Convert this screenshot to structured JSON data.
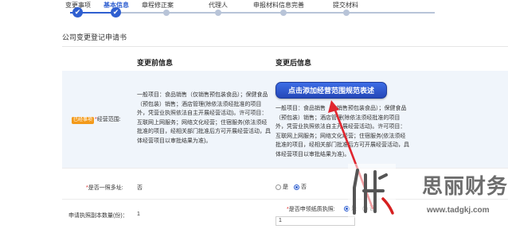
{
  "stepper": {
    "steps": [
      {
        "label": "变更事项",
        "state": "done"
      },
      {
        "label": "基本信息",
        "state": "active"
      },
      {
        "label": "章程修正案",
        "state": "todo"
      },
      {
        "label": "代理人",
        "state": "todo"
      },
      {
        "label": "申报材料信息完善",
        "state": "todo"
      },
      {
        "label": "提交材料",
        "state": "todo"
      }
    ],
    "check_glyph": "✔"
  },
  "form": {
    "title": "公司变更登记申请书",
    "col_before": "变更前信息",
    "col_after": "变更后信息",
    "scope": {
      "badge": "已经事项",
      "required_mark": "*",
      "label": "经营范围:",
      "before_text": "一般项目：食品销售（仅销售预包装食品）；保健食品（预包装）销售；酒店管理(除依法须经批准的项目外，凭营业执照依法自主开展经营活动)。许可项目：互联网上网服务；网络文化经营；住宿服务(依法须经批准的项目，经相关部门批准后方可开展经营活动，具体经营项目以审批结果为准)。",
      "after_text": "一般项目：食品销售（仅销售预包装食品）；保健食品（预包装）销售；酒店管理(除依法须经批准的项目外，凭营业执照依法自主开展经营活动)。许可项目：互联网上网服务；网络文化经营；住宿服务(依法须经批准的项目，经相关部门批准后方可开展经营活动，具体经营项目以审批结果为准)。",
      "button_label": "点击添加经营范围规范表述"
    },
    "multi_address": {
      "required_mark": "*",
      "label": "是否一照多址:",
      "before_value": "否",
      "options": [
        "是",
        "否"
      ],
      "selected": "否"
    },
    "receive_license": {
      "required_mark": "*",
      "label": "是否申领纸质执照:",
      "options": [
        "是",
        "否"
      ],
      "selected": "是"
    },
    "copies": {
      "label": "申请执照副本数量(份)：",
      "before_value": "1",
      "after_value": "1"
    }
  },
  "watermark": {
    "brand": "思丽财务",
    "url": "www.tadgkj.com"
  },
  "colors": {
    "accent": "#2f5fd0",
    "button": "#2447b8",
    "badge": "#f39a1a",
    "arrow": "#e0262f",
    "row_bg": "#f0f5fb"
  }
}
